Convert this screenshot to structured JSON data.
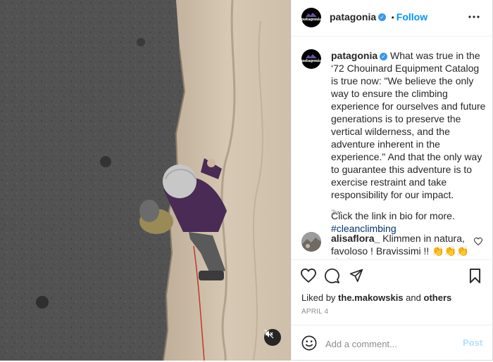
{
  "post": {
    "username": "patagonia",
    "avatar_text": "patagonia",
    "follow_label": "Follow",
    "separator": "•",
    "more_icon": "more-horizontal-icon"
  },
  "caption": {
    "username": "patagonia",
    "text": "What was true in the ‘72 Chouinard Equipment Catalog is true now: \"We believe the only way to ensure the climbing experience for ourselves and future generations is to preserve the vertical wilderness, and the adventure inherent in the experience.\" And that the only way to guarantee this adventure is to exercise restraint and take responsibility for our impact.",
    "link_line": "Click the link in bio for more.",
    "hashtag": "#cleanclimbing",
    "age": "3w"
  },
  "comment": {
    "username": "alisaflora_",
    "text": "Klimmen in natura, favoloso ! Bravissimi !! 👏👏👏🔥🔥👏"
  },
  "actions": {
    "liked_by_prefix": "Liked by",
    "liked_by_user": "the.makowskis",
    "liked_by_and": "and",
    "liked_by_others": "others",
    "date": "APRIL 4"
  },
  "add_comment": {
    "placeholder": "Add a comment...",
    "post_label": "Post"
  },
  "colors": {
    "accent": "#0095f6",
    "verified": "#3897f0",
    "muted": "#8e8e8e",
    "hashtag": "#00376b"
  }
}
